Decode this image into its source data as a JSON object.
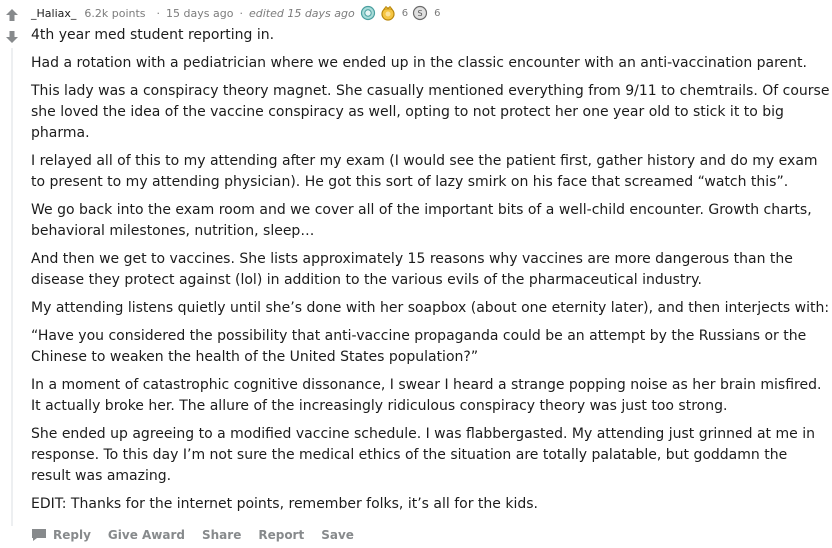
{
  "comment": {
    "author": "_Haliax_",
    "points": "6.2k points",
    "separator": "·",
    "time": "15 days ago",
    "edited": "edited 15 days ago",
    "awards": [
      {
        "icon": "platinum-award-icon",
        "count": ""
      },
      {
        "icon": "gold-award-icon",
        "count": "6"
      },
      {
        "icon": "silver-award-icon",
        "count": "6"
      }
    ],
    "paragraphs": [
      "4th year med student reporting in.",
      "Had a rotation with a pediatrician where we ended up in the classic encounter with an anti-vaccination parent.",
      "This lady was a conspiracy theory magnet. She casually mentioned everything from 9/11 to chemtrails. Of course she loved the idea of the vaccine conspiracy as well, opting to not protect her one year old to stick it to big pharma.",
      "I relayed all of this to my attending after my exam (I would see the patient first, gather history and do my exam to present to my attending physician). He got this sort of lazy smirk on his face that screamed “watch this”.",
      "We go back into the exam room and we cover all of the important bits of a well-child encounter. Growth charts, behavioral milestones, nutrition, sleep…",
      "And then we get to vaccines. She lists approximately 15 reasons why vaccines are more dangerous than the disease they protect against (lol) in addition to the various evils of the pharmaceutical industry.",
      "My attending listens quietly until she’s done with her soapbox (about one eternity later), and then interjects with:",
      "“Have you considered the possibility that anti-vaccine propaganda could be an attempt by the Russians or the Chinese to weaken the health of the United States population?”",
      "In a moment of catastrophic cognitive dissonance, I swear I heard a strange popping noise as her brain misfired. It actually broke her. The allure of the increasingly ridiculous conspiracy theory was just too strong.",
      "She ended up agreeing to a modified vaccine schedule. I was flabbergasted. My attending just grinned at me in response. To this day I’m not sure the medical ethics of the situation are totally palatable, but goddamn the result was amazing.",
      "EDIT: Thanks for the internet points, remember folks, it’s all for the kids."
    ],
    "actions": {
      "reply": "Reply",
      "give_award": "Give Award",
      "share": "Share",
      "report": "Report",
      "save": "Save"
    }
  },
  "colors": {
    "upvote": "#878a8c",
    "meta_text": "#7c7c7c",
    "body_text": "#1c1c1c",
    "thread_line": "#edeff1"
  }
}
